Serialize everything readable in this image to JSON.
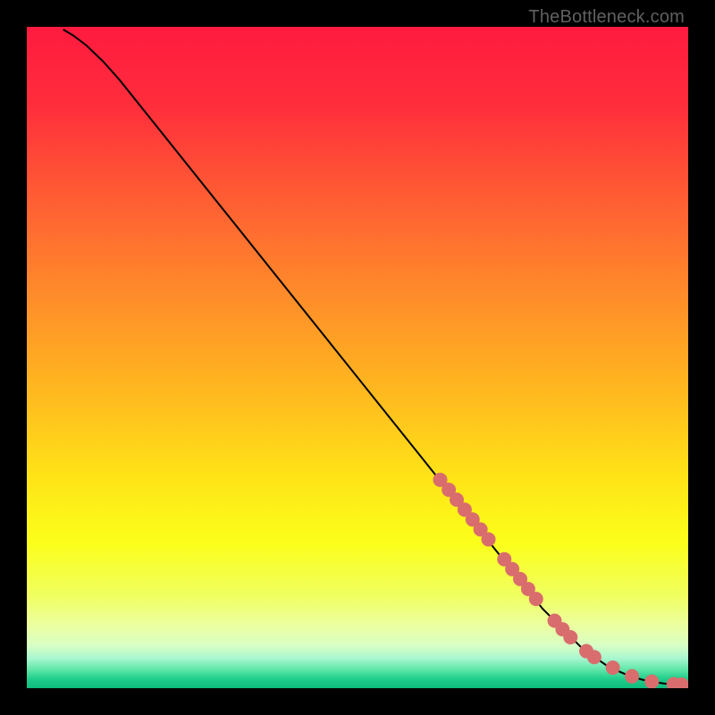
{
  "attribution": "TheBottleneck.com",
  "chart_data": {
    "type": "line",
    "title": "",
    "xlabel": "",
    "ylabel": "",
    "xlim": [
      0,
      100
    ],
    "ylim": [
      0,
      100
    ],
    "grid": false,
    "legend": false,
    "background_gradient": {
      "stops": [
        {
          "offset": 0.0,
          "color": "#ff1a3f"
        },
        {
          "offset": 0.12,
          "color": "#ff2e3c"
        },
        {
          "offset": 0.25,
          "color": "#ff5a34"
        },
        {
          "offset": 0.4,
          "color": "#ff8a2a"
        },
        {
          "offset": 0.55,
          "color": "#ffb81f"
        },
        {
          "offset": 0.68,
          "color": "#ffe317"
        },
        {
          "offset": 0.78,
          "color": "#fbff1a"
        },
        {
          "offset": 0.86,
          "color": "#f0ff60"
        },
        {
          "offset": 0.905,
          "color": "#ecffa0"
        },
        {
          "offset": 0.935,
          "color": "#d8ffc4"
        },
        {
          "offset": 0.955,
          "color": "#a8f7cf"
        },
        {
          "offset": 0.972,
          "color": "#5fe6a8"
        },
        {
          "offset": 0.985,
          "color": "#22cf8c"
        },
        {
          "offset": 1.0,
          "color": "#0dbb7c"
        }
      ]
    },
    "series": [
      {
        "name": "curve",
        "color": "#000000",
        "x": [
          5.5,
          7.0,
          9.0,
          11.5,
          14.0,
          18.0,
          24.0,
          30.0,
          38.0,
          46.0,
          54.0,
          62.0,
          70.0,
          78.0,
          84.0,
          88.0,
          91.0,
          93.0,
          95.0,
          96.5,
          97.8,
          98.6,
          99.2
        ],
        "y": [
          99.6,
          98.7,
          97.2,
          94.8,
          92.0,
          87.0,
          79.5,
          72.0,
          62.0,
          52.0,
          42.0,
          32.0,
          22.0,
          12.0,
          6.0,
          3.2,
          1.9,
          1.3,
          0.9,
          0.7,
          0.6,
          0.55,
          0.5
        ]
      }
    ],
    "markers": {
      "name": "highlight-points",
      "color": "#d96d6d",
      "radius_px": 8,
      "x": [
        62.5,
        63.8,
        65.0,
        66.2,
        67.4,
        68.6,
        69.8,
        72.2,
        73.4,
        74.6,
        75.8,
        77.0,
        79.8,
        81.0,
        82.2,
        84.6,
        85.8,
        88.6,
        91.5,
        94.5,
        97.8,
        99.0
      ],
      "y": [
        31.5,
        30.0,
        28.5,
        27.0,
        25.5,
        24.0,
        22.5,
        19.5,
        18.0,
        16.5,
        15.0,
        13.5,
        10.2,
        8.9,
        7.7,
        5.6,
        4.7,
        3.1,
        1.8,
        1.0,
        0.6,
        0.55
      ]
    }
  }
}
